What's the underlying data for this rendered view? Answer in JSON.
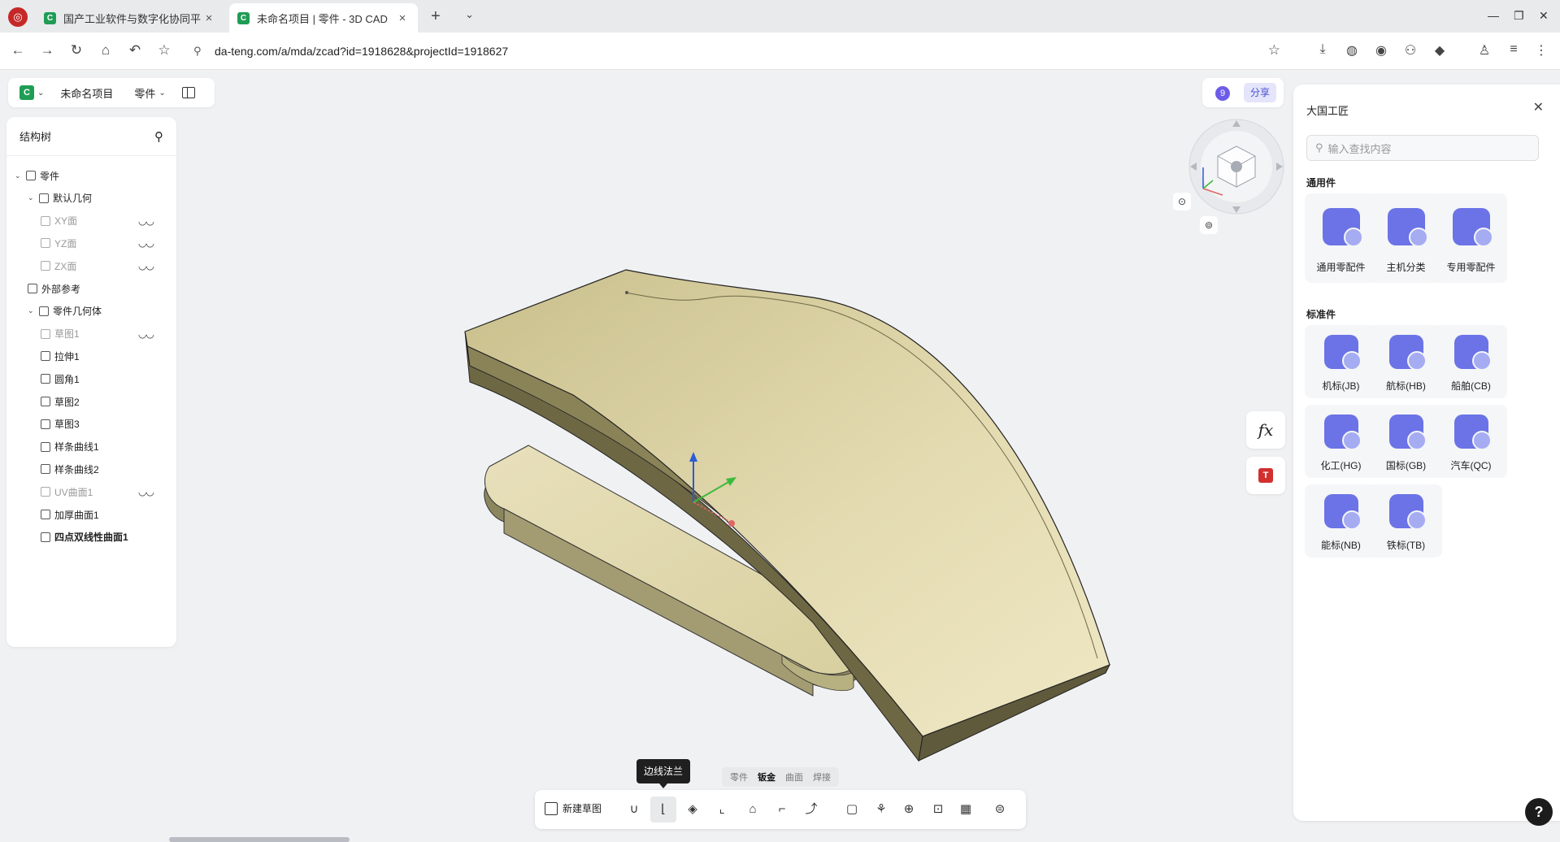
{
  "browser": {
    "tabs": [
      {
        "title": "国产工业软件与数字化协同平",
        "active": false
      },
      {
        "title": "未命名项目 | 零件 - 3D CAD",
        "active": true
      }
    ],
    "url": "da-teng.com/a/mda/zcad?id=1918628&projectId=1918627"
  },
  "app": {
    "project_name": "未命名项目",
    "part_type": "零件",
    "user_count": "9",
    "share_label": "分享",
    "fx_label": "fx"
  },
  "tree": {
    "title": "结构树",
    "items": [
      {
        "label": "零件",
        "level": 0,
        "expanded": true,
        "dim": false,
        "hidden": false,
        "bold": false
      },
      {
        "label": "默认几何",
        "level": 1,
        "expanded": true,
        "dim": false,
        "hidden": false,
        "bold": false
      },
      {
        "label": "XY面",
        "level": 2,
        "dim": true,
        "hidden": true,
        "bold": false
      },
      {
        "label": "YZ面",
        "level": 2,
        "dim": true,
        "hidden": true,
        "bold": false
      },
      {
        "label": "ZX面",
        "level": 2,
        "dim": true,
        "hidden": true,
        "bold": false
      },
      {
        "label": "外部参考",
        "level": 1,
        "dim": false,
        "hidden": false,
        "bold": false
      },
      {
        "label": "零件几何体",
        "level": 1,
        "expanded": true,
        "dim": false,
        "hidden": false,
        "bold": false
      },
      {
        "label": "草图1",
        "level": 2,
        "dim": true,
        "hidden": true,
        "bold": false
      },
      {
        "label": "拉伸1",
        "level": 2,
        "dim": false,
        "hidden": false,
        "bold": false
      },
      {
        "label": "圆角1",
        "level": 2,
        "dim": false,
        "hidden": false,
        "bold": false
      },
      {
        "label": "草图2",
        "level": 2,
        "dim": false,
        "hidden": false,
        "bold": false
      },
      {
        "label": "草图3",
        "level": 2,
        "dim": false,
        "hidden": false,
        "bold": false
      },
      {
        "label": "样条曲线1",
        "level": 2,
        "dim": false,
        "hidden": false,
        "bold": false
      },
      {
        "label": "样条曲线2",
        "level": 2,
        "dim": false,
        "hidden": false,
        "bold": false
      },
      {
        "label": "UV曲面1",
        "level": 2,
        "dim": true,
        "hidden": true,
        "bold": false
      },
      {
        "label": "加厚曲面1",
        "level": 2,
        "dim": false,
        "hidden": false,
        "bold": false
      },
      {
        "label": "四点双线性曲面1",
        "level": 2,
        "dim": false,
        "hidden": false,
        "bold": true
      }
    ]
  },
  "library": {
    "title": "大国工匠",
    "search_placeholder": "输入查找内容",
    "general_title": "通用件",
    "general": [
      "通用零配件",
      "主机分类",
      "专用零配件"
    ],
    "standard_title": "标准件",
    "standard": [
      "机标(JB)",
      "航标(HB)",
      "船舶(CB)",
      "化工(HG)",
      "国标(GB)",
      "汽车(QC)",
      "能标(NB)",
      "铁标(TB)"
    ]
  },
  "bottom": {
    "tooltip": "边线法兰",
    "mode_tabs": [
      "零件",
      "钣金",
      "曲面",
      "焊接"
    ],
    "active_mode": "钣金",
    "new_sketch_label": "新建草图",
    "tools": [
      "u-bend-icon",
      "edge-flange-icon",
      "sheet-icon",
      "hem-icon",
      "jog-icon",
      "bend-icon",
      "break-icon",
      "flatten-icon",
      "stamp-icon",
      "target-icon",
      "unfold-icon",
      "pattern-icon",
      "stack-icon"
    ]
  },
  "colors": {
    "accent": "#6c5ce7",
    "model_face": "#d9d0a0",
    "model_side": "#7a7350",
    "icon_blue": "#6b73e6"
  }
}
